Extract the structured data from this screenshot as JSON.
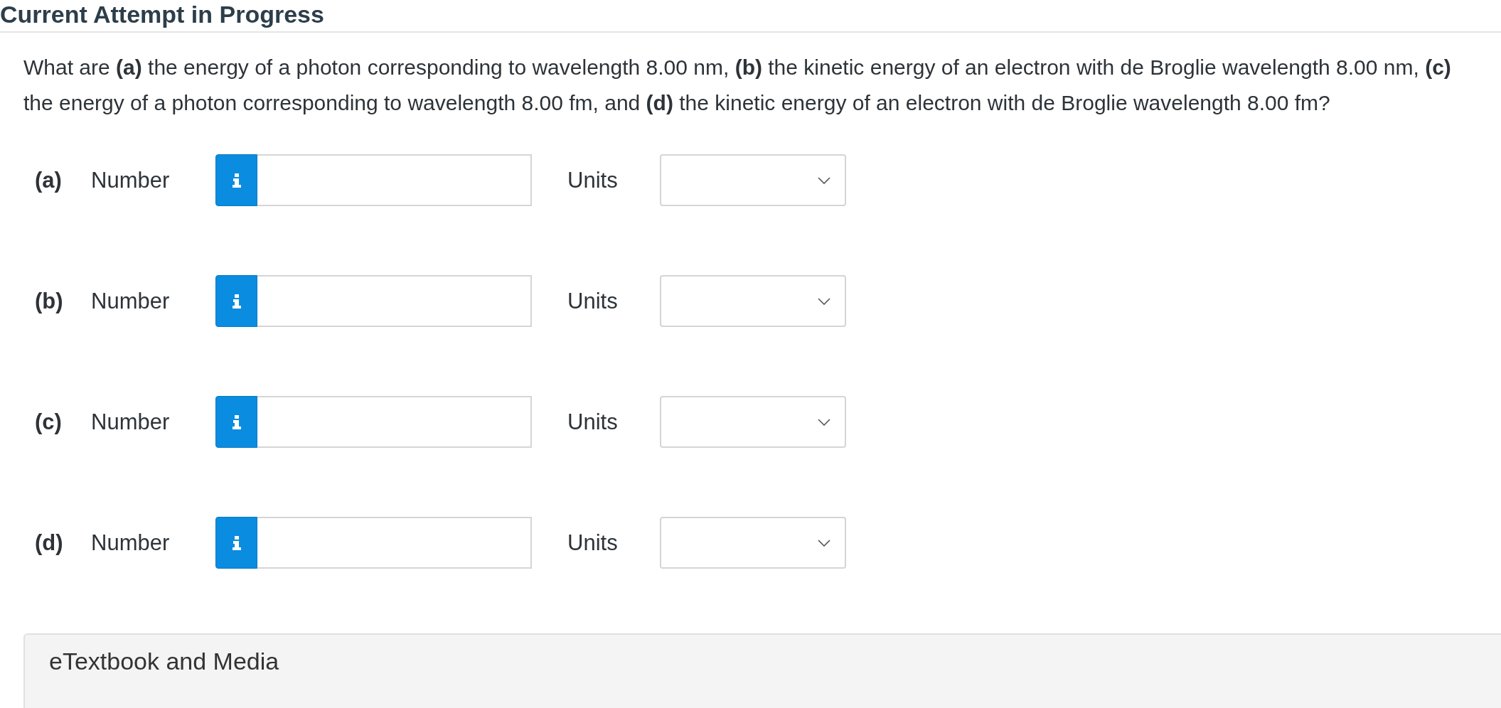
{
  "header": {
    "title": "Current Attempt in Progress"
  },
  "question": {
    "text": "What are **(a)** the energy of a photon corresponding to wavelength 8.00 nm, **(b)** the kinetic energy of an electron with de Broglie wavelength 8.00 nm, **(c)** the energy of a photon corresponding to wavelength 8.00 fm, and **(d)** the kinetic energy of an electron with de Broglie wavelength 8.00 fm?"
  },
  "answers": [
    {
      "part": "(a)",
      "number_label": "Number",
      "units_label": "Units"
    },
    {
      "part": "(b)",
      "number_label": "Number",
      "units_label": "Units"
    },
    {
      "part": "(c)",
      "number_label": "Number",
      "units_label": "Units"
    },
    {
      "part": "(d)",
      "number_label": "Number",
      "units_label": "Units"
    }
  ],
  "etextbook": {
    "title": "eTextbook and Media"
  }
}
